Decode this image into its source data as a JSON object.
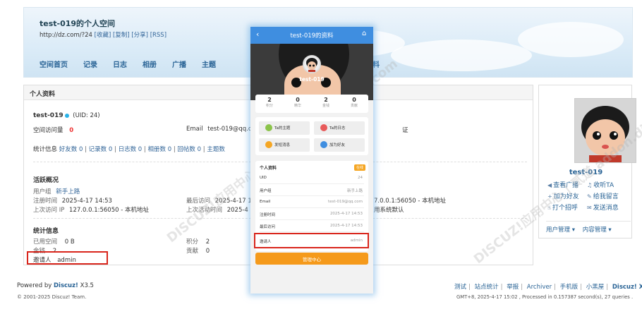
{
  "header": {
    "title": "test-019的个人空间",
    "url": "http://dz.com/?24",
    "url_actions": [
      "[收藏]",
      "[复制]",
      "[分享]",
      "[RSS]"
    ],
    "nav": [
      "空间首页",
      "记录",
      "日志",
      "相册",
      "广播",
      "主题"
    ],
    "nav_partial": "料"
  },
  "panel": {
    "title": "个人资料",
    "username": "test-019",
    "uid": "(UID: 24)",
    "visits_label": "空间访问量",
    "visits_value": "0",
    "email_label": "Email",
    "email_value": "test-019@qq.com",
    "verify_partial": "证",
    "stats_label": "统计信息",
    "stats": [
      {
        "label": "好友数",
        "value": "0"
      },
      {
        "label": "记录数",
        "value": "0"
      },
      {
        "label": "日志数",
        "value": "0"
      },
      {
        "label": "相册数",
        "value": "0"
      },
      {
        "label": "回帖数",
        "value": "0"
      },
      {
        "label": "主题数",
        "value": ""
      }
    ],
    "active_title": "活跃概况",
    "group_label": "用户组",
    "group_value": "新手上路",
    "reg_label": "注册时间",
    "reg_value": "2025-4-17 14:53",
    "last_visit_label": "最后访问",
    "last_visit_value": "2025-4-17 1",
    "last_ip_label": "上次访问 IP",
    "last_ip_value": "127.0.0.1:56050 - 本机地址",
    "last_active_label": "上次活动时间",
    "last_active_value": "2025-4",
    "reg_ip_partial": "7.0.0.1:56050 - 本机地址",
    "timezone_partial": "用系统默认",
    "stat_title": "统计信息",
    "used_space_label": "已用空间",
    "used_space_value": "0 B",
    "points_label": "积分",
    "points_value": "2",
    "coins_label": "金钱",
    "coins_value": "2",
    "contrib_label": "贡献",
    "contrib_value": "0",
    "inviter_label": "邀请人",
    "inviter_value": "admin"
  },
  "sidebar": {
    "name": "test-019",
    "actions": [
      {
        "icon": "broadcast-icon",
        "glyph": "◀",
        "label": "查看广播"
      },
      {
        "icon": "listen-icon",
        "glyph": "♫",
        "label": "收听TA"
      },
      {
        "icon": "add-friend-icon",
        "glyph": "+",
        "label": "加为好友"
      },
      {
        "icon": "message-icon",
        "glyph": "✎",
        "label": "给我留言"
      },
      {
        "icon": "greet-icon",
        "glyph": "☝",
        "label": "打个招呼"
      },
      {
        "icon": "mail-icon",
        "glyph": "✉",
        "label": "发送消息"
      }
    ],
    "menu_user": "用户管理",
    "menu_content": "内容管理"
  },
  "footer": {
    "powered_prefix": "Powered by ",
    "powered_brand": "Discuz!",
    "powered_version": " X3.5",
    "copyright": "© 2001-2025 Discuz! Team.",
    "links": [
      "测试",
      "站点统计",
      "举报",
      "Archiver",
      "手机版",
      "小黑屋",
      "Discuz! X"
    ],
    "info": "GMT+8, 2025-4-17 15:02 , Processed in 0.157387 second(s), 27 queries ."
  },
  "mobile": {
    "title": "test-019的资料",
    "name": "test-019",
    "stats": [
      {
        "value": "2",
        "label": "积分"
      },
      {
        "value": "0",
        "label": "精华"
      },
      {
        "value": "2",
        "label": "金钱"
      },
      {
        "value": "0",
        "label": "贡献"
      }
    ],
    "buttons": [
      {
        "label": "Ta的主题",
        "color": "#8bc34a"
      },
      {
        "label": "Ta的日志",
        "color": "#e85a5a"
      },
      {
        "label": "发短消息",
        "color": "#f5a623"
      },
      {
        "label": "加为好友",
        "color": "#3f8ee0"
      }
    ],
    "info_title": "个人资料",
    "online": "在线",
    "rows": [
      {
        "label": "UID",
        "value": "24"
      },
      {
        "label": "用户组",
        "value": "新手上路"
      },
      {
        "label": "Email",
        "value": "test-019@qq.com"
      },
      {
        "label": "注册时间",
        "value": "2025-4-17 14:53"
      },
      {
        "label": "最后访问",
        "value": "2025-4-17 14:53"
      },
      {
        "label": "邀请人",
        "value": "admin"
      }
    ],
    "manage_label": "管理中心"
  },
  "watermark": "DISCUZ!应用中心 | 贰道 addon.dismall.com"
}
